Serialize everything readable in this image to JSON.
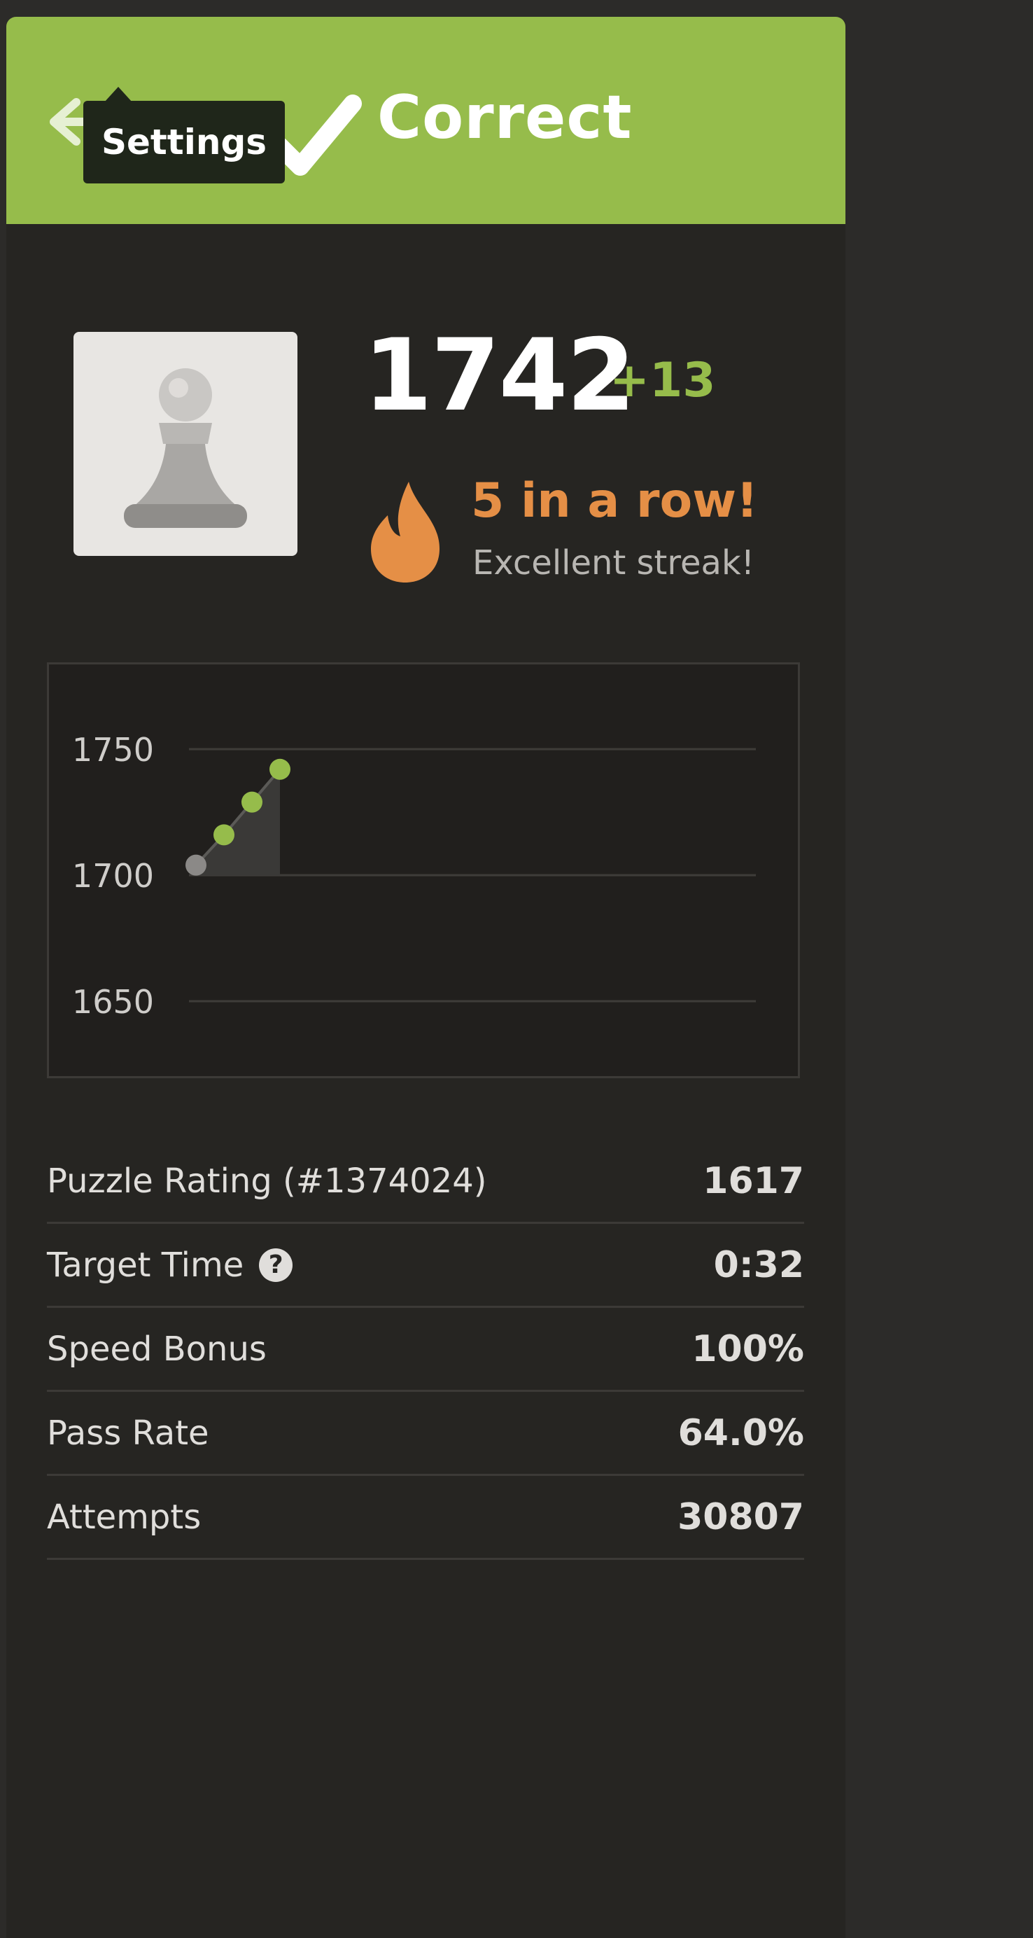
{
  "header": {
    "title": "Correct",
    "tooltip": "Settings",
    "accent_color": "#96bc4b",
    "icons": [
      "back-arrow-icon",
      "settings-icon",
      "check-icon"
    ]
  },
  "rating": {
    "value": "1742",
    "delta": "+13",
    "avatar_icon": "pawn-icon"
  },
  "streak": {
    "title": "5 in a row!",
    "subtitle": "Excellent streak!",
    "icon": "flame-icon",
    "color": "#e58f46"
  },
  "chart_data": {
    "type": "line",
    "x": [
      1,
      2,
      3,
      4
    ],
    "series": [
      {
        "values": [
          1704,
          1716,
          1729,
          1742
        ]
      }
    ],
    "yticks": [
      1750,
      1700,
      1650
    ],
    "ylim": [
      1640,
      1760
    ],
    "grid": true,
    "point_colors": [
      "#8b8987",
      "#96bc4b",
      "#96bc4b",
      "#96bc4b"
    ]
  },
  "stats": {
    "rows": [
      {
        "label": "Puzzle Rating (#1374024)",
        "value": "1617",
        "help": false
      },
      {
        "label": "Target Time",
        "value": "0:32",
        "help": true,
        "help_symbol": "?"
      },
      {
        "label": "Speed Bonus",
        "value": "100%",
        "help": false
      },
      {
        "label": "Pass Rate",
        "value": "64.0%",
        "help": false
      },
      {
        "label": "Attempts",
        "value": "30807",
        "help": false
      }
    ]
  }
}
